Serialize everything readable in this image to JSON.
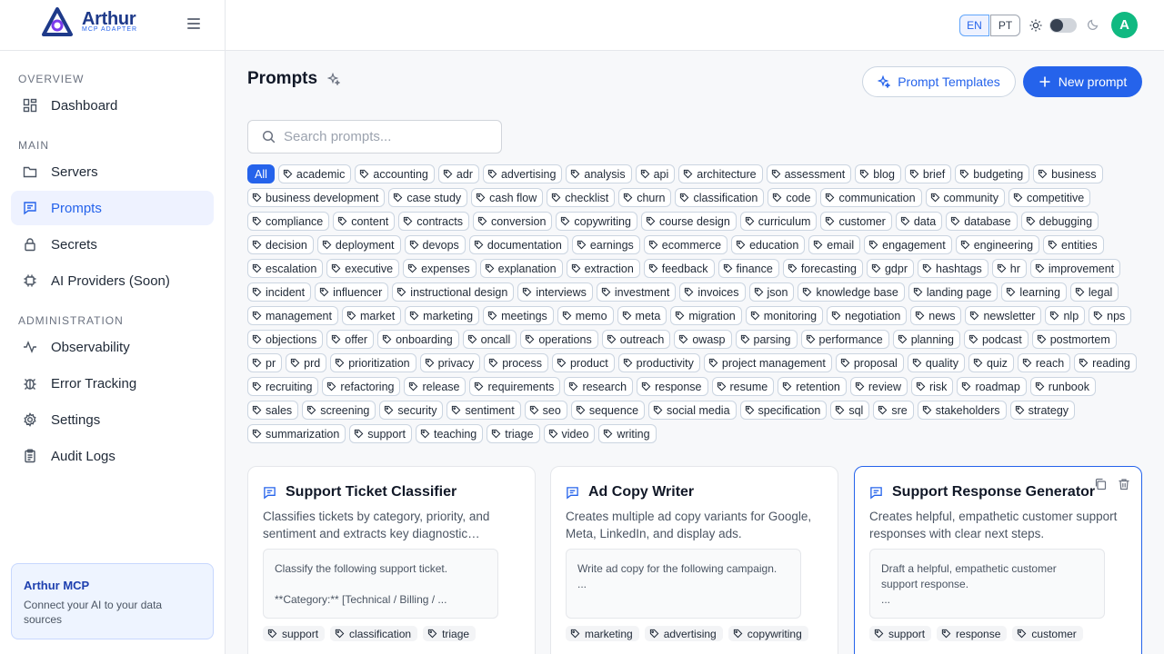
{
  "brand": {
    "name": "Arthur",
    "subtitle": "MCP ADAPTER"
  },
  "sidebar": {
    "sections": [
      {
        "label": "OVERVIEW"
      },
      {
        "label": "MAIN"
      },
      {
        "label": "ADMINISTRATION"
      }
    ],
    "items": [
      {
        "label": "Dashboard",
        "icon": "dashboard-icon"
      },
      {
        "label": "Servers",
        "icon": "folder-icon"
      },
      {
        "label": "Prompts",
        "icon": "message-icon",
        "active": true
      },
      {
        "label": "Secrets",
        "icon": "lock-icon"
      },
      {
        "label": "AI Providers (Soon)",
        "icon": "chip-icon"
      },
      {
        "label": "Observability",
        "icon": "activity-icon"
      },
      {
        "label": "Error Tracking",
        "icon": "bug-icon"
      },
      {
        "label": "Settings",
        "icon": "gear-icon"
      },
      {
        "label": "Audit Logs",
        "icon": "clipboard-icon"
      }
    ],
    "promo": {
      "title": "Arthur MCP",
      "text": "Connect your AI to your data sources"
    }
  },
  "header": {
    "lang_en": "EN",
    "lang_pt": "PT",
    "avatar_initial": "A",
    "colors": {
      "accent": "#2563eb",
      "avatar": "#10b981"
    }
  },
  "main": {
    "title": "Prompts",
    "templates_button": "Prompt Templates",
    "new_button": "New prompt",
    "search_placeholder": "Search prompts...",
    "tags": [
      "All",
      "academic",
      "accounting",
      "adr",
      "advertising",
      "analysis",
      "api",
      "architecture",
      "assessment",
      "blog",
      "brief",
      "budgeting",
      "business",
      "business development",
      "case study",
      "cash flow",
      "checklist",
      "churn",
      "classification",
      "code",
      "communication",
      "community",
      "competitive",
      "compliance",
      "content",
      "contracts",
      "conversion",
      "copywriting",
      "course design",
      "curriculum",
      "customer",
      "data",
      "database",
      "debugging",
      "decision",
      "deployment",
      "devops",
      "documentation",
      "earnings",
      "ecommerce",
      "education",
      "email",
      "engagement",
      "engineering",
      "entities",
      "escalation",
      "executive",
      "expenses",
      "explanation",
      "extraction",
      "feedback",
      "finance",
      "forecasting",
      "gdpr",
      "hashtags",
      "hr",
      "improvement",
      "incident",
      "influencer",
      "instructional design",
      "interviews",
      "investment",
      "invoices",
      "json",
      "knowledge base",
      "landing page",
      "learning",
      "legal",
      "management",
      "market",
      "marketing",
      "meetings",
      "memo",
      "meta",
      "migration",
      "monitoring",
      "negotiation",
      "news",
      "newsletter",
      "nlp",
      "nps",
      "objections",
      "offer",
      "onboarding",
      "oncall",
      "operations",
      "outreach",
      "owasp",
      "parsing",
      "performance",
      "planning",
      "podcast",
      "postmortem",
      "pr",
      "prd",
      "prioritization",
      "privacy",
      "process",
      "product",
      "productivity",
      "project management",
      "proposal",
      "quality",
      "quiz",
      "reach",
      "reading",
      "recruiting",
      "refactoring",
      "release",
      "requirements",
      "research",
      "response",
      "resume",
      "retention",
      "review",
      "risk",
      "roadmap",
      "runbook",
      "sales",
      "screening",
      "security",
      "sentiment",
      "seo",
      "sequence",
      "social media",
      "specification",
      "sql",
      "sre",
      "stakeholders",
      "strategy",
      "summarization",
      "support",
      "teaching",
      "triage",
      "video",
      "writing"
    ],
    "cards": [
      {
        "title": "Support Ticket Classifier",
        "description": "Classifies tickets by category, priority, and sentiment and extracts key diagnostic…",
        "preview": "Classify the following support ticket.\n\n**Category:** [Technical / Billing / ...",
        "tags": [
          "support",
          "classification",
          "triage"
        ]
      },
      {
        "title": "Ad Copy Writer",
        "description": "Creates multiple ad copy variants for Google, Meta, LinkedIn, and display ads.",
        "preview": "Write ad copy for the following campaign.\n...",
        "tags": [
          "marketing",
          "advertising",
          "copywriting"
        ]
      },
      {
        "title": "Support Response Generator",
        "description": "Creates helpful, empathetic customer support responses with clear next steps.",
        "preview": "Draft a helpful, empathetic customer support response.\n...",
        "tags": [
          "support",
          "response",
          "customer"
        ]
      }
    ]
  }
}
